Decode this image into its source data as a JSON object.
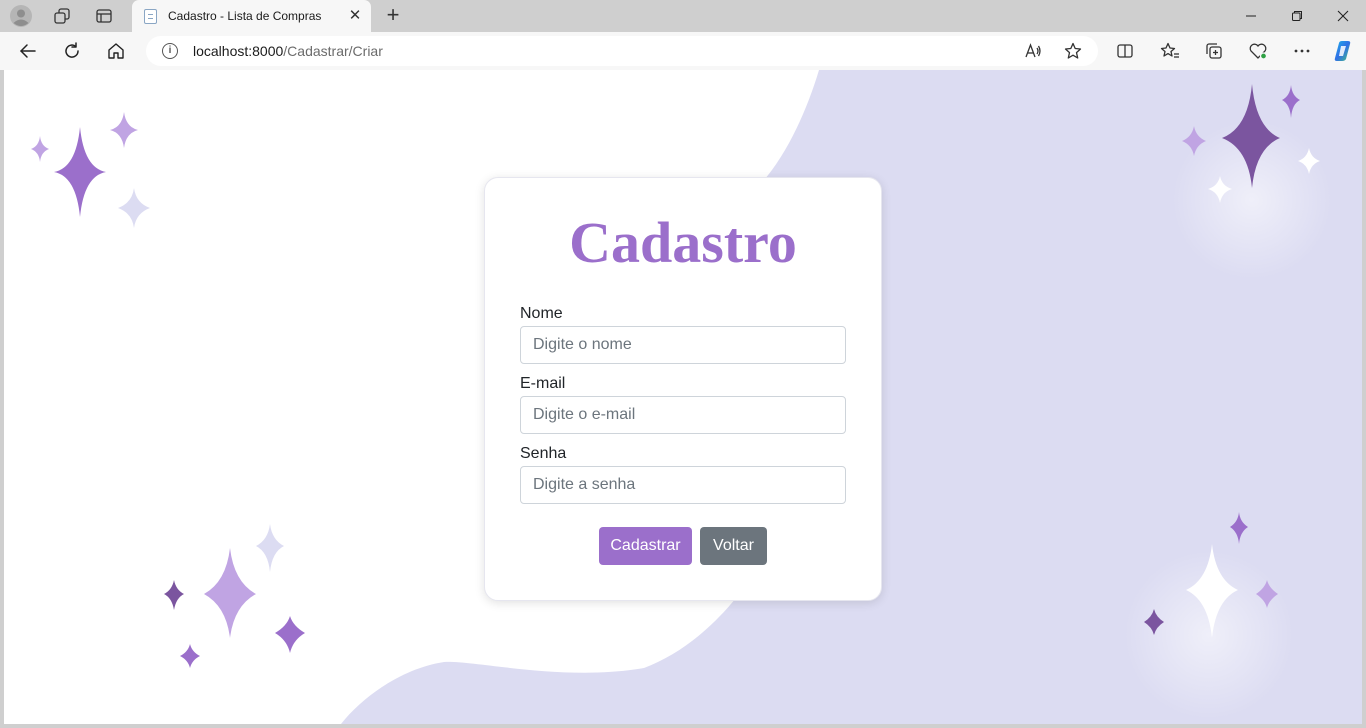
{
  "browser": {
    "tab_title": "Cadastro - Lista de Compras",
    "tab_close": "✕",
    "new_tab": "+",
    "url_host": "localhost:8000",
    "url_path": "/Cadastrar/Criar",
    "info_icon": "i"
  },
  "card": {
    "title": "Cadastro",
    "fields": [
      {
        "label": "Nome",
        "placeholder": "Digite o nome"
      },
      {
        "label": "E-mail",
        "placeholder": "Digite o e-mail"
      },
      {
        "label": "Senha",
        "placeholder": "Digite a senha"
      }
    ],
    "submit_label": "Cadastrar",
    "back_label": "Voltar"
  },
  "colors": {
    "accent": "#9b6fcb",
    "secondary": "#6c757d",
    "background_blob": "#dcdcf2",
    "sparkle_dark": "#7b559f",
    "sparkle_mid": "#9b6fcb",
    "sparkle_light": "#c0a4e3"
  }
}
